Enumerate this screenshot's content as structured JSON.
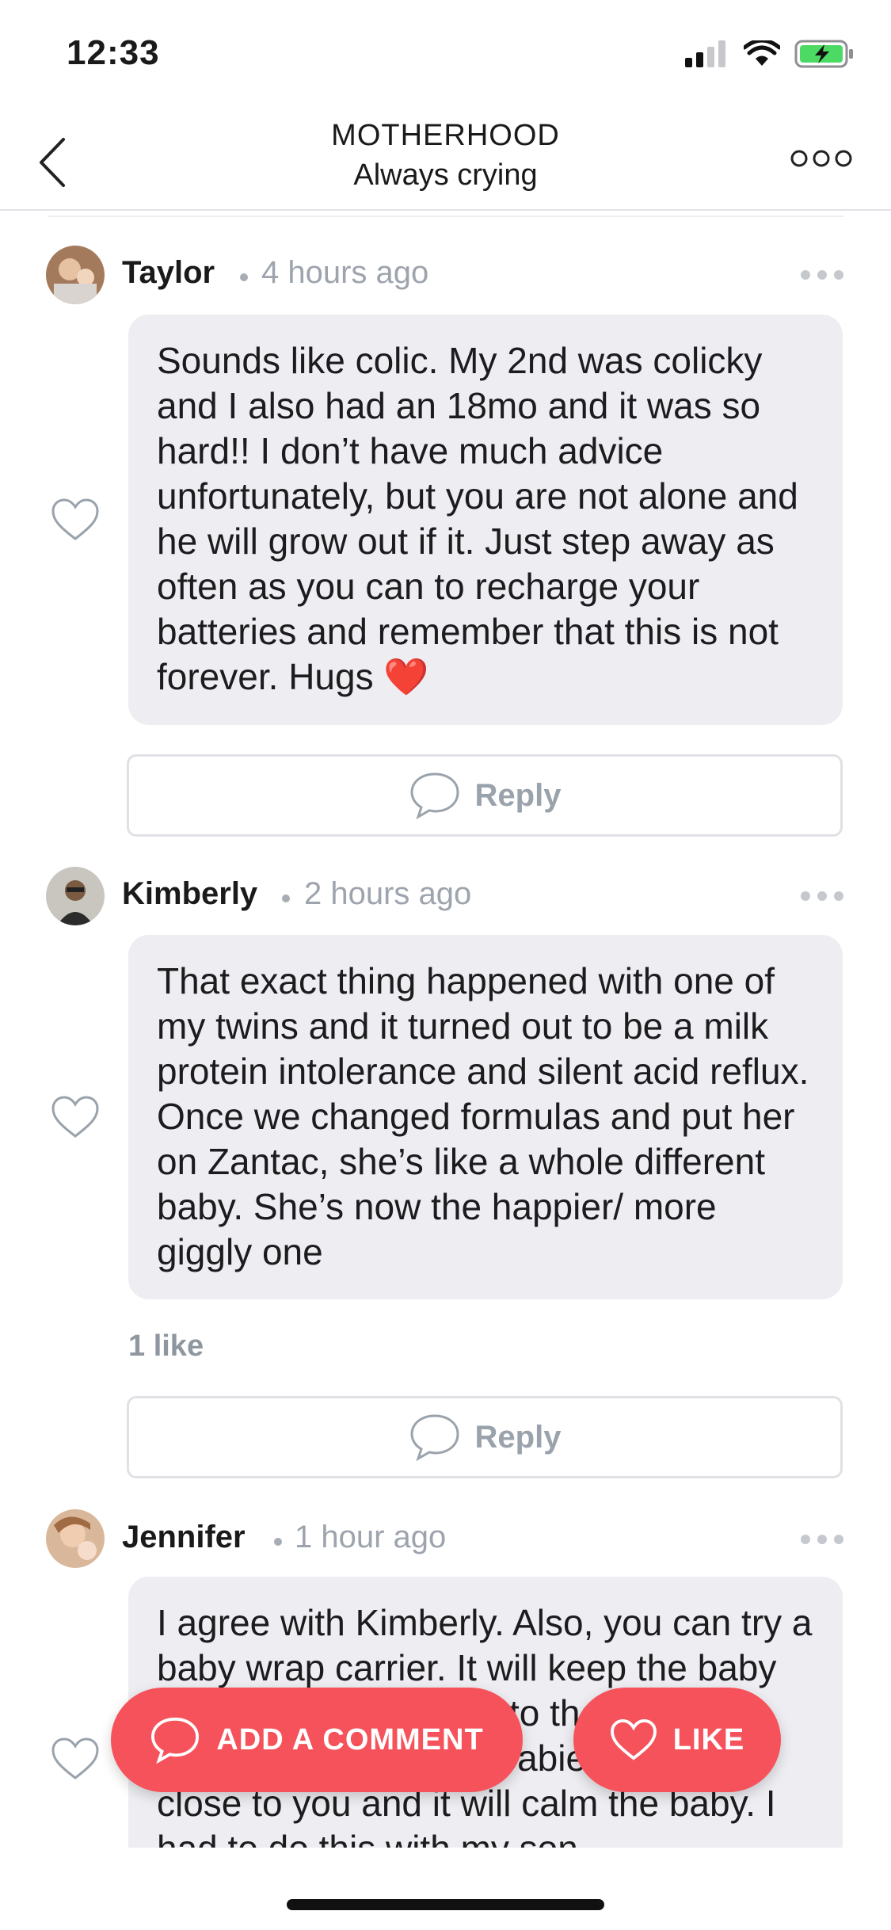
{
  "status": {
    "time": "12:33"
  },
  "nav": {
    "title": "MOTHERHOOD",
    "subtitle": "Always crying"
  },
  "comments": [
    {
      "author": "Taylor",
      "time": "4 hours ago",
      "text": "Sounds like colic. My 2nd was colicky and I also had an 18mo and it was so hard!! I don’t have much advice unfortunately, but you are not alone and he will grow out if it. Just step away as often as you can to recharge your batteries and remember that this is not forever. Hugs ❤️",
      "likes": "",
      "reply_label": "Reply"
    },
    {
      "author": "Kimberly",
      "time": "2 hours ago",
      "text": "That exact thing happened with one of my twins and it turned out to be a milk protein intolerance and silent acid reflux. Once we changed formulas and put her on Zantac, she’s like a whole different baby. She’s now the happier/ more giggly one",
      "likes": "1 like",
      "reply_label": "Reply"
    },
    {
      "author": "Jennifer",
      "time": "1 hour ago",
      "text": "I agree with Kimberly. Also, you can try a baby wrap carrier. It will keep the baby close to you because to them being close to their mother babies like to be close to you and it will calm the baby. I had to do this with my son"
    }
  ],
  "actions": {
    "add_comment": "ADD A COMMENT",
    "like": "LIKE"
  },
  "colors": {
    "accent": "#f6525b",
    "bubble": "#eeeef2",
    "muted": "#9ea4ad"
  }
}
